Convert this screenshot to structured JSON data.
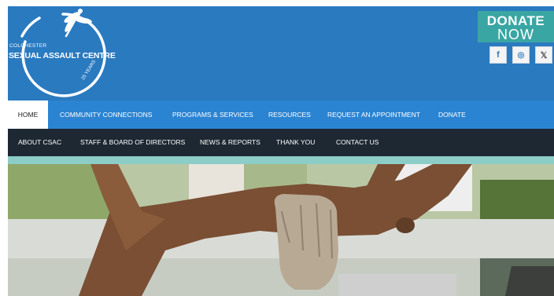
{
  "logo": {
    "line1": "COLCHESTER",
    "line2": "SEXUAL ASSAULT CENTRE",
    "years": "25 YEARS",
    "icon": "dragonfly-icon"
  },
  "donate": {
    "line1": "DONATE",
    "line2": "NOW"
  },
  "social": [
    {
      "icon": "facebook-icon",
      "glyph": "f"
    },
    {
      "icon": "instagram-icon",
      "glyph": "◎"
    },
    {
      "icon": "x-icon",
      "glyph": "𝕏"
    }
  ],
  "nav_primary": [
    {
      "label": "HOME",
      "active": true
    },
    {
      "label": "COMMUNITY CONNECTIONS"
    },
    {
      "label": "PROGRAMS & SERVICES"
    },
    {
      "label": "RESOURCES"
    },
    {
      "label": "REQUEST AN APPOINTMENT"
    },
    {
      "label": "DONATE"
    }
  ],
  "nav_secondary": [
    {
      "label": "ABOUT CSAC"
    },
    {
      "label": "STAFF & BOARD OF DIRECTORS"
    },
    {
      "label": "NEWS & REPORTS"
    },
    {
      "label": "THANK YOU"
    },
    {
      "label": "CONTACT US"
    }
  ],
  "colors": {
    "header_blue": "#2a7ac0",
    "nav_blue": "#2b84d2",
    "nav_dark": "#1d2833",
    "teal": "#3aa6a3"
  },
  "hero": {
    "image": "sculpted hand gripping tree branch in park"
  }
}
